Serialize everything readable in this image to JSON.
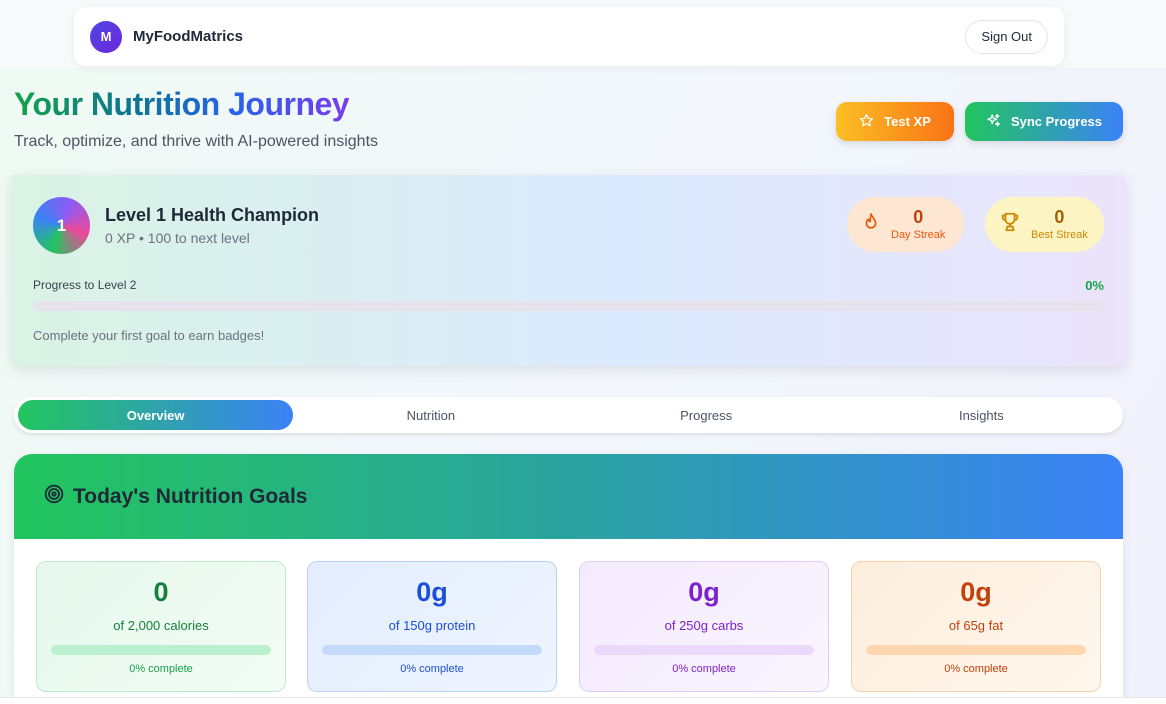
{
  "navbar": {
    "logo_letter": "M",
    "brand": "MyFoodMatrics",
    "sign_out": "Sign Out"
  },
  "hero": {
    "title": "Your Nutrition Journey",
    "subtitle": "Track, optimize, and thrive with AI-powered insights",
    "test_xp_label": "Test XP",
    "sync_label": "Sync Progress"
  },
  "level": {
    "number": "1",
    "title": "Level 1 Health Champion",
    "subtitle": "0 XP • 100 to next level",
    "day_streak_value": "0",
    "day_streak_label": "Day Streak",
    "best_streak_value": "0",
    "best_streak_label": "Best Streak",
    "progress_label": "Progress to Level 2",
    "progress_percent": "0%",
    "progress_fraction": 0,
    "badges_message": "Complete your first goal to earn badges!"
  },
  "tabs": [
    {
      "label": "Overview",
      "active": true
    },
    {
      "label": "Nutrition",
      "active": false
    },
    {
      "label": "Progress",
      "active": false
    },
    {
      "label": "Insights",
      "active": false
    }
  ],
  "goals": {
    "title": "Today's Nutrition Goals",
    "items": [
      {
        "value": "0",
        "target": "of 2,000 calories",
        "percent_text": "0% complete",
        "fraction": 0
      },
      {
        "value": "0g",
        "target": "of 150g protein",
        "percent_text": "0% complete",
        "fraction": 0
      },
      {
        "value": "0g",
        "target": "of 250g carbs",
        "percent_text": "0% complete",
        "fraction": 0
      },
      {
        "value": "0g",
        "target": "of 65g fat",
        "percent_text": "0% complete",
        "fraction": 0
      }
    ]
  },
  "icons": {
    "test_xp": "star-icon",
    "sync": "sparkles-icon",
    "day_streak": "flame-icon",
    "best_streak": "trophy-icon",
    "goals": "target-icon"
  },
  "colors": {
    "accent_green": "#22c55e",
    "accent_blue": "#3b82f6",
    "calories": "#15803d",
    "protein": "#1d4ed8",
    "carbs": "#7e22ce",
    "fat": "#c2410c",
    "streak_orange": "#ea580c",
    "streak_gold": "#ca8a04"
  }
}
